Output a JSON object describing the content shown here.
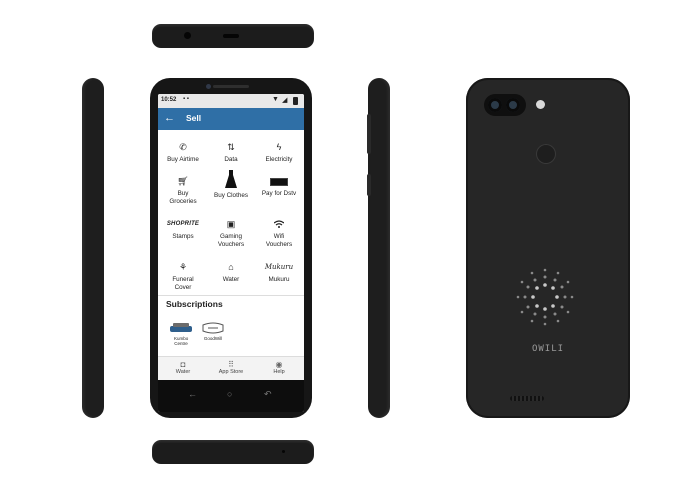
{
  "device": {
    "brand_mark": "OWILI"
  },
  "status_bar": {
    "time": "10:52"
  },
  "app_bar": {
    "back_icon": "arrow-left-icon",
    "title": "Sell"
  },
  "tiles": [
    {
      "label": "Buy Airtime",
      "icon": "phone-plus-icon"
    },
    {
      "label": "Data",
      "icon": "data-arrows-icon"
    },
    {
      "label": "Electricity",
      "icon": "bolt-icon"
    },
    {
      "label": "Buy Groceries",
      "icon": "cart-icon"
    },
    {
      "label": "Buy Clothes",
      "icon": "dress-icon"
    },
    {
      "label": "Pay for Dstv",
      "icon": "dstv-logo"
    },
    {
      "label": "Stamps",
      "icon": "shoprite-logo",
      "logo_text": "SHOPRITE"
    },
    {
      "label": "Gaming Vouchers",
      "icon": "gift-icon"
    },
    {
      "label": "Wifi Vouchers",
      "icon": "wifi-icon"
    },
    {
      "label": "Funeral Cover",
      "icon": "hands-plant-icon"
    },
    {
      "label": "Water",
      "icon": "house-drop-icon"
    },
    {
      "label": "Mukuru",
      "icon": "mukuru-logo",
      "logo_text": "Mukuru"
    }
  ],
  "subscriptions": {
    "heading": "Subscriptions",
    "items": [
      {
        "label": "Kumbo Centre",
        "icon": "kumbo-logo"
      },
      {
        "label": "GoodWill",
        "icon": "goodwill-logo"
      }
    ]
  },
  "bottom_nav": [
    {
      "label": "Water",
      "icon": "water-icon"
    },
    {
      "label": "App Store",
      "icon": "grid-icon"
    },
    {
      "label": "Help",
      "icon": "help-icon"
    }
  ]
}
